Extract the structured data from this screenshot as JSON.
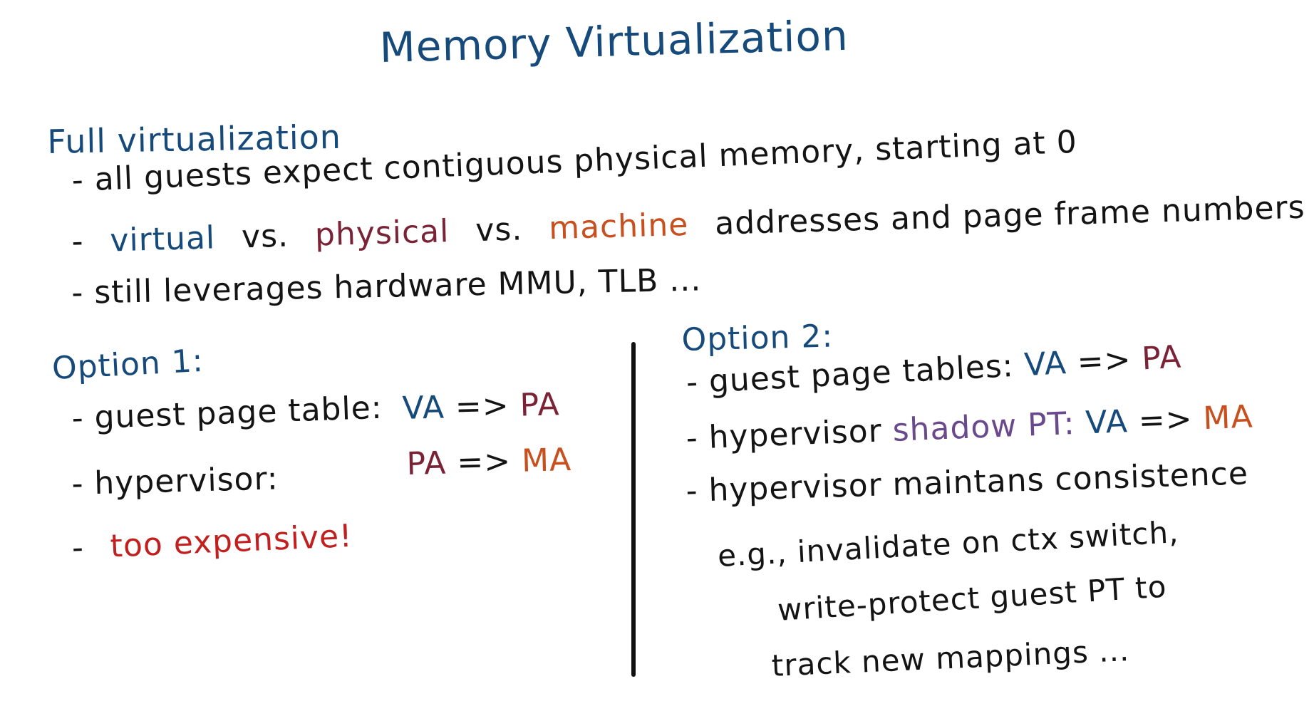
{
  "title": "Memory Virtualization",
  "full_virtualization": {
    "heading": "Full virtualization",
    "bullets": {
      "b1": "- all guests expect contiguous physical memory, starting at 0",
      "b2": {
        "dash": "-",
        "virtual": "virtual",
        "vs1": "vs.",
        "physical": "physical",
        "vs2": "vs.",
        "machine": "machine",
        "rest": "addresses and page frame numbers"
      },
      "b3": "- still leverages hardware MMU, TLB ..."
    }
  },
  "option1": {
    "heading": "Option 1:",
    "guest_line": "- guest page table:",
    "guest_map": {
      "from": "VA",
      "arrow": "=>",
      "to": "PA"
    },
    "hyper_line": "- hypervisor:",
    "hyper_map": {
      "from": "PA",
      "arrow": "=>",
      "to": "MA"
    },
    "cost_dash": "-",
    "cost": "too expensive!"
  },
  "option2": {
    "heading": "Option 2:",
    "guest_line": "- guest page tables:",
    "guest_map": {
      "from": "VA",
      "arrow": "=>",
      "to": "PA"
    },
    "shadow_prefix": "- hypervisor",
    "shadow_label": "shadow PT:",
    "shadow_map": {
      "from": "VA",
      "arrow": "=>",
      "to": "MA"
    },
    "maintain": "- hypervisor maintans consistence",
    "eg1": "e.g., invalidate on ctx switch,",
    "eg2": "write-protect guest PT to",
    "eg3": "track new mappings ..."
  },
  "colors": {
    "ink_black": "#141414",
    "ink_blue": "#164a7a",
    "ink_maroon": "#7a2236",
    "ink_orange": "#c8501e",
    "ink_red": "#c21f1f",
    "ink_purple": "#6a4a8c"
  }
}
